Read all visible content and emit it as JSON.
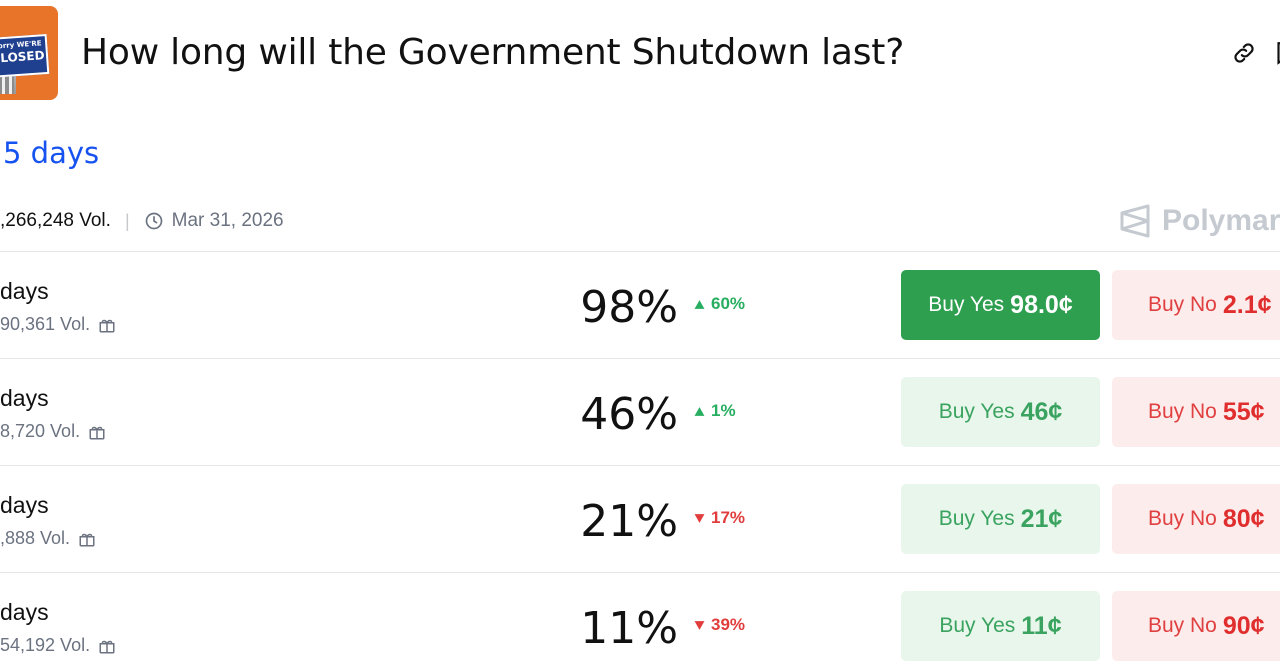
{
  "header": {
    "thumbnail": {
      "sign_line1": "Sorry WE'RE",
      "sign_line2": "CLOSED"
    },
    "title": "How long will the Government Shutdown last?",
    "icons": [
      "link-icon",
      "bookmark-icon"
    ]
  },
  "leading": {
    "label": "5 days",
    "color": "#1652f0"
  },
  "meta": {
    "volume": ",266,248 Vol.",
    "date": "Mar 31, 2026",
    "brand": "Polymark"
  },
  "colors": {
    "up": "#27ae60",
    "down": "#e23d3d",
    "yes_active": "#2e9e4f",
    "yes_light": "#e8f6ec",
    "no_light": "#fdecec"
  },
  "outcomes": [
    {
      "label": "days",
      "volume": "90,361 Vol.",
      "probability": "98%",
      "change": "60%",
      "direction": "up",
      "yes_label": "Buy Yes",
      "yes_price": "98.0¢",
      "no_label": "Buy No",
      "no_price": "2.1¢",
      "yes_active": true
    },
    {
      "label": "days",
      "volume": "8,720 Vol.",
      "probability": "46%",
      "change": "1%",
      "direction": "up",
      "yes_label": "Buy Yes",
      "yes_price": "46¢",
      "no_label": "Buy No",
      "no_price": "55¢",
      "yes_active": false
    },
    {
      "label": "days",
      "volume": ",888 Vol.",
      "probability": "21%",
      "change": "17%",
      "direction": "down",
      "yes_label": "Buy Yes",
      "yes_price": "21¢",
      "no_label": "Buy No",
      "no_price": "80¢",
      "yes_active": false
    },
    {
      "label": "days",
      "volume": "54,192 Vol.",
      "probability": "11%",
      "change": "39%",
      "direction": "down",
      "yes_label": "Buy Yes",
      "yes_price": "11¢",
      "no_label": "Buy No",
      "no_price": "90¢",
      "yes_active": false
    }
  ]
}
